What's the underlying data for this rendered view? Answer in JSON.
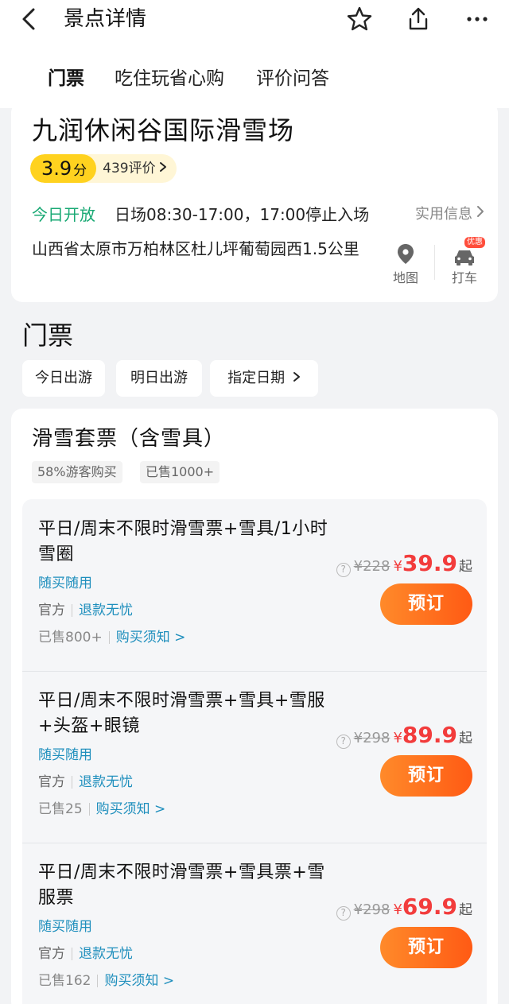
{
  "header": {
    "title": "景点详情",
    "icons": [
      "back-icon",
      "star-icon",
      "share-icon",
      "more-icon"
    ]
  },
  "tabs": [
    {
      "label": "门票",
      "active": true
    },
    {
      "label": "吃住玩省心购",
      "active": false
    },
    {
      "label": "评价问答",
      "active": false
    }
  ],
  "spot": {
    "name": "九润休闲谷国际滑雪场",
    "score": "3.9",
    "score_unit": "分",
    "review_count": "439评价",
    "open_status": "今日开放",
    "hours": "日场08:30-17:00，17:00停止入场",
    "practical_info": "实用信息",
    "address": "山西省太原市万柏林区杜儿坪葡萄园西1.5公里",
    "map_label": "地图",
    "taxi_label": "打车",
    "taxi_promo": "优惠"
  },
  "tickets": {
    "section_title": "门票",
    "date_chips": [
      "今日出游",
      "明日出游",
      "指定日期"
    ],
    "package": {
      "title": "滑雪套票（含雪具）",
      "tags": [
        "58%游客购买",
        "已售1000+"
      ]
    },
    "offers": [
      {
        "name": "平日/周末不限时滑雪票+雪具/1小时雪圈",
        "feature": "随买随用",
        "official": "官方",
        "refund": "退款无忧",
        "sold": "已售800+",
        "notice": "购买须知 >",
        "orig_price": "¥228",
        "price_sign": "¥",
        "price": "39.9",
        "price_suffix": "起",
        "book": "预订"
      },
      {
        "name": "平日/周末不限时滑雪票+雪具+雪服+头盔+眼镜",
        "feature": "随买随用",
        "official": "官方",
        "refund": "退款无忧",
        "sold": "已售25",
        "notice": "购买须知 >",
        "orig_price": "¥298",
        "price_sign": "¥",
        "price": "89.9",
        "price_suffix": "起",
        "book": "预订"
      },
      {
        "name": "平日/周末不限时滑雪票+雪具票+雪服票",
        "feature": "随买随用",
        "official": "官方",
        "refund": "退款无忧",
        "sold": "已售162",
        "notice": "购买须知 >",
        "orig_price": "¥298",
        "price_sign": "¥",
        "price": "69.9",
        "price_suffix": "起",
        "book": "预订"
      }
    ]
  },
  "colors": {
    "accent_yellow": "#ffd21f",
    "open_green": "#19a974",
    "link_blue": "#1f8fbd",
    "price_red": "#f23c3c",
    "book_orange": "#ff6a1e"
  }
}
